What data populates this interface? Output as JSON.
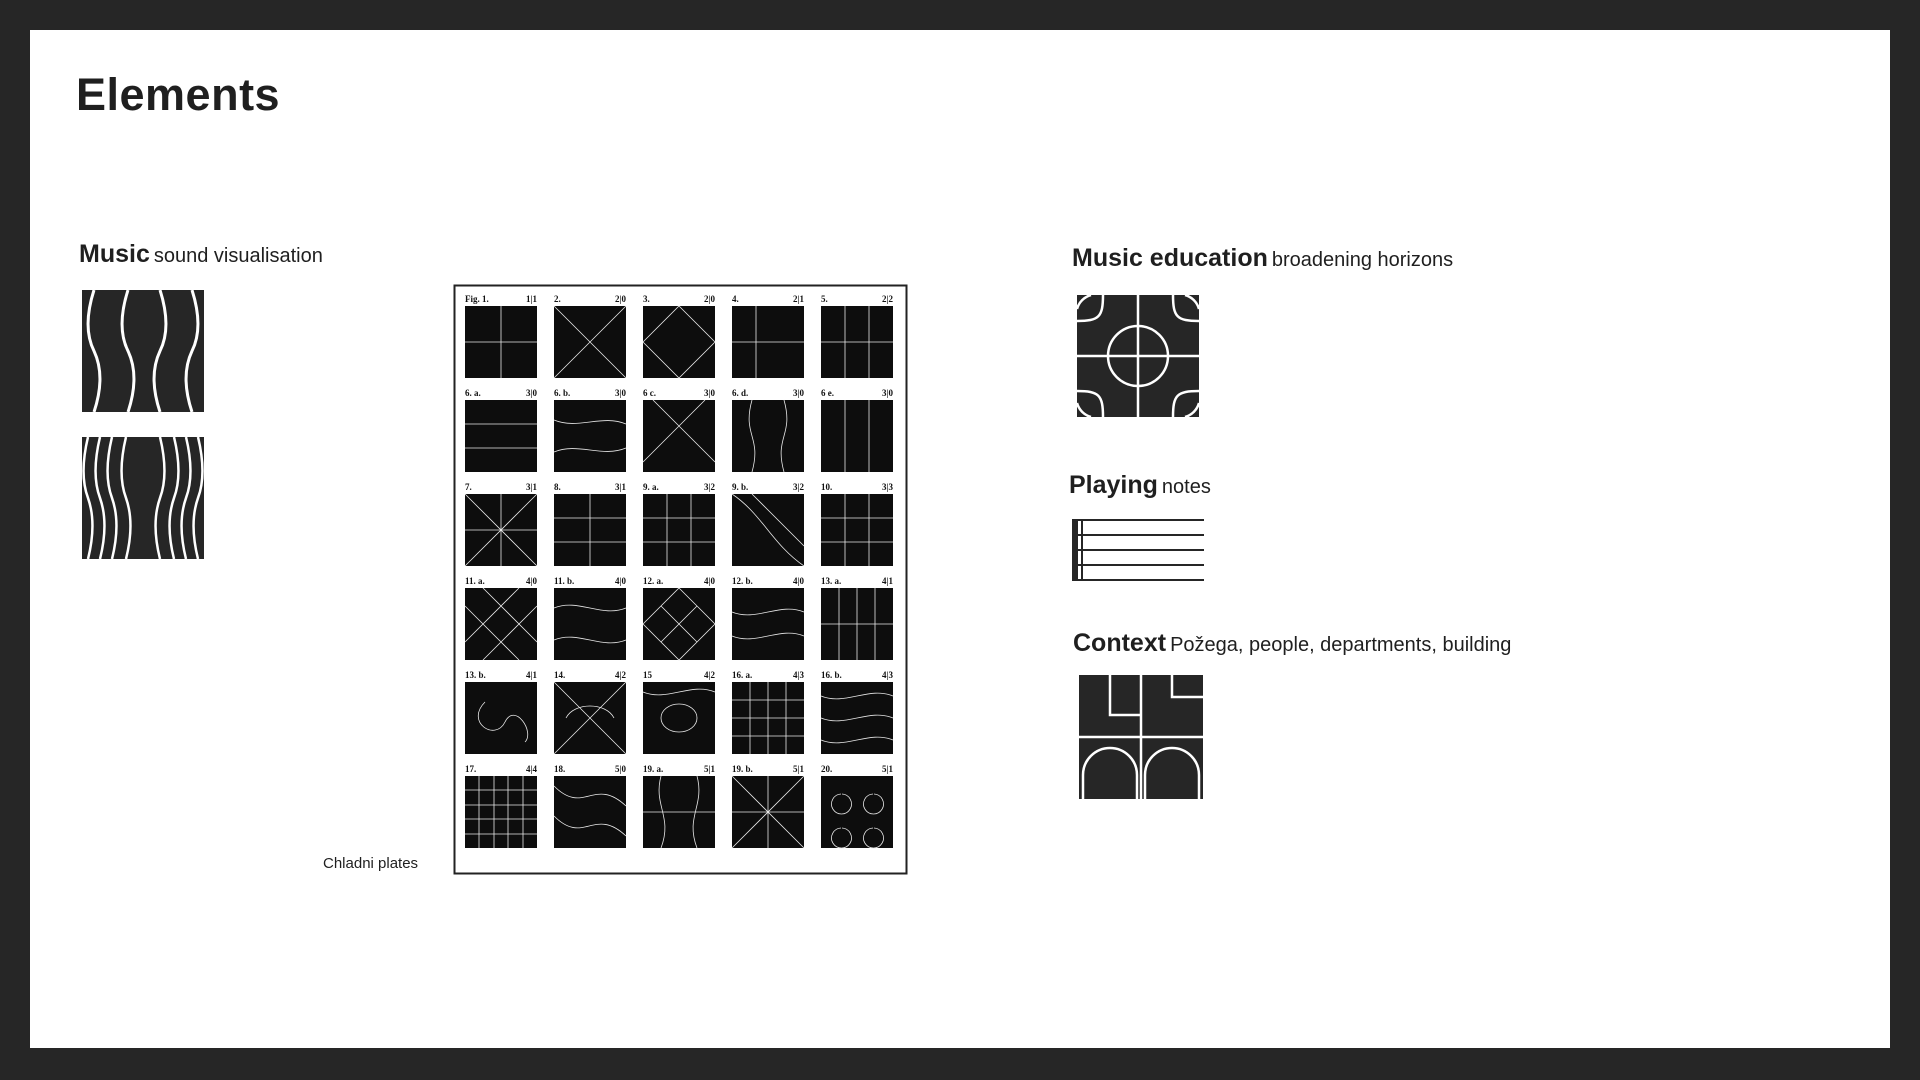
{
  "page": {
    "title": "Elements"
  },
  "sections": {
    "music": {
      "title": "Music",
      "subtitle": "sound visualisation"
    },
    "chladni": {
      "caption": "Chladni plates"
    },
    "education": {
      "title": "Music education",
      "subtitle": "broadening horizons"
    },
    "playing": {
      "title": "Playing",
      "subtitle": "notes"
    },
    "context": {
      "title": "Context",
      "subtitle": "Požega, people, departments, building"
    }
  },
  "chladni_figures": [
    {
      "label": "Fig. 1.",
      "num": "1|1"
    },
    {
      "label": "2.",
      "num": "2|0"
    },
    {
      "label": "3.",
      "num": "2|0"
    },
    {
      "label": "4.",
      "num": "2|1"
    },
    {
      "label": "5.",
      "num": "2|2"
    },
    {
      "label": "6. a.",
      "num": "3|0"
    },
    {
      "label": "6. b.",
      "num": "3|0"
    },
    {
      "label": "6 c.",
      "num": "3|0"
    },
    {
      "label": "6. d.",
      "num": "3|0"
    },
    {
      "label": "6 e.",
      "num": "3|0"
    },
    {
      "label": "7.",
      "num": "3|1"
    },
    {
      "label": "8.",
      "num": "3|1"
    },
    {
      "label": "9. a.",
      "num": "3|2"
    },
    {
      "label": "9. b.",
      "num": "3|2"
    },
    {
      "label": "10.",
      "num": "3|3"
    },
    {
      "label": "11. a.",
      "num": "4|0"
    },
    {
      "label": "11. b.",
      "num": "4|0"
    },
    {
      "label": "12. a.",
      "num": "4|0"
    },
    {
      "label": "12. b.",
      "num": "4|0"
    },
    {
      "label": "13. a.",
      "num": "4|1"
    },
    {
      "label": "13. b.",
      "num": "4|1"
    },
    {
      "label": "14.",
      "num": "4|2"
    },
    {
      "label": "15",
      "num": "4|2"
    },
    {
      "label": "16. a.",
      "num": "4|3"
    },
    {
      "label": "16. b.",
      "num": "4|3"
    },
    {
      "label": "17.",
      "num": "4|4"
    },
    {
      "label": "18.",
      "num": "5|0"
    },
    {
      "label": "19. a.",
      "num": "5|1"
    },
    {
      "label": "19. b.",
      "num": "5|1"
    },
    {
      "label": "20.",
      "num": "5|1"
    }
  ],
  "colors": {
    "frame": "#262626",
    "ink": "#1f1f1f",
    "paper": "#ffffff"
  }
}
